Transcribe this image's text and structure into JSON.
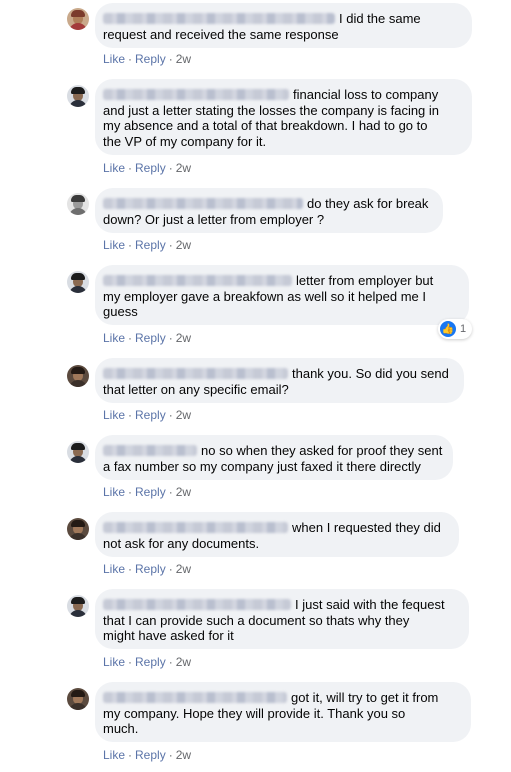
{
  "actions": {
    "like": "Like",
    "reply": "Reply",
    "time": "2w",
    "separator": "·"
  },
  "colors": {
    "bubble": "#f0f2f5",
    "meta": "#65676b",
    "link": "#5b74a8",
    "like_blue": "#1877f2"
  },
  "icons": {
    "reaction": "thumbs-up-icon"
  },
  "comments": [
    {
      "lines": [
        "I did the same",
        "request and received the same response"
      ]
    },
    {
      "lines": [
        "financial loss to company",
        "and just a letter stating the losses the company is facing in",
        "my absence and a total of that breakdown. I had to go to",
        "the VP of my company for it."
      ]
    },
    {
      "lines": [
        "do they ask for break",
        "down? Or just a letter from employer ?"
      ]
    },
    {
      "lines": [
        "letter from employer but",
        "my employer gave a breakfown as well so it helped me I",
        "guess"
      ],
      "reaction_count": "1"
    },
    {
      "lines": [
        "thank you. So did you send",
        "that letter on any specific email?"
      ]
    },
    {
      "lines": [
        "no so when they asked for proof they sent",
        "a fax number so my company just faxed it there directly"
      ]
    },
    {
      "lines": [
        "when I requested they did",
        "not ask for any documents."
      ]
    },
    {
      "lines": [
        "I just said with the fequest",
        "that I can provide such a document so thats why they",
        "might have asked for it"
      ]
    },
    {
      "lines": [
        "got it, will try to get it from",
        "my company. Hope they will provide it. Thank you so",
        "much."
      ]
    }
  ]
}
